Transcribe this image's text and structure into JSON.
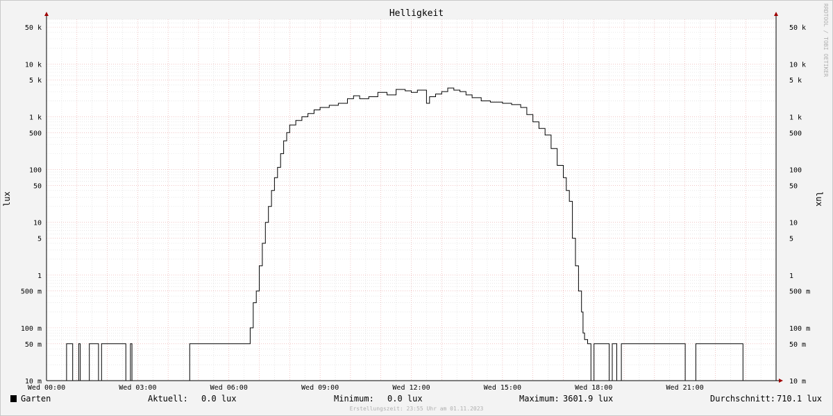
{
  "title": "Helligkeit",
  "side_credit": "RRDTOOL / TOBI OETIKER",
  "footer_text": "Erstellungszeit: 23:55 Uhr am 01.11.2023",
  "legend": {
    "series_name": "Garten",
    "series_color": "#000000",
    "current_label": "Aktuell:",
    "current_value": "0.0 lux",
    "min_label": "Minimum:",
    "min_value": "0.0 lux",
    "max_label": "Maximum:",
    "max_value": "3601.9 lux",
    "avg_label": "Durchschnitt:",
    "avg_value": "710.1 lux"
  },
  "colors": {
    "background": "#ffffff",
    "major_grid": "#e8a0a0",
    "minor_grid": "#d8d8d8",
    "axis": "#000000",
    "arrow": "#a00000",
    "line": "#000000"
  },
  "chart_data": {
    "type": "line",
    "title": "Helligkeit",
    "xlabel": "",
    "ylabel": "lux",
    "y_scale": "log",
    "ylim": [
      0.01,
      70000
    ],
    "xlim": [
      0,
      24
    ],
    "grid": true,
    "x_ticks": [
      {
        "value": 0,
        "label": "Wed 00:00"
      },
      {
        "value": 3,
        "label": "Wed 03:00"
      },
      {
        "value": 6,
        "label": "Wed 06:00"
      },
      {
        "value": 9,
        "label": "Wed 09:00"
      },
      {
        "value": 12,
        "label": "Wed 12:00"
      },
      {
        "value": 15,
        "label": "Wed 15:00"
      },
      {
        "value": 18,
        "label": "Wed 18:00"
      },
      {
        "value": 21,
        "label": "Wed 21:00"
      }
    ],
    "y_ticks": [
      {
        "value": 0.01,
        "label": "10 m"
      },
      {
        "value": 0.05,
        "label": "50 m"
      },
      {
        "value": 0.1,
        "label": "100 m"
      },
      {
        "value": 0.5,
        "label": "500 m"
      },
      {
        "value": 1,
        "label": "1"
      },
      {
        "value": 5,
        "label": "5"
      },
      {
        "value": 10,
        "label": "10"
      },
      {
        "value": 50,
        "label": "50"
      },
      {
        "value": 100,
        "label": "100"
      },
      {
        "value": 500,
        "label": "500"
      },
      {
        "value": 1000,
        "label": "1 k"
      },
      {
        "value": 5000,
        "label": "5 k"
      },
      {
        "value": 10000,
        "label": "10 k"
      },
      {
        "value": 50000,
        "label": "50 k"
      }
    ],
    "series": [
      {
        "name": "Garten",
        "points": [
          [
            0.0,
            0.01
          ],
          [
            0.65,
            0.01
          ],
          [
            0.66,
            0.05
          ],
          [
            0.85,
            0.05
          ],
          [
            0.86,
            0.01
          ],
          [
            1.05,
            0.01
          ],
          [
            1.06,
            0.05
          ],
          [
            1.1,
            0.05
          ],
          [
            1.11,
            0.01
          ],
          [
            1.4,
            0.01
          ],
          [
            1.41,
            0.05
          ],
          [
            1.7,
            0.05
          ],
          [
            1.71,
            0.01
          ],
          [
            1.8,
            0.01
          ],
          [
            1.81,
            0.05
          ],
          [
            2.6,
            0.05
          ],
          [
            2.61,
            0.01
          ],
          [
            2.75,
            0.01
          ],
          [
            2.76,
            0.05
          ],
          [
            2.8,
            0.05
          ],
          [
            2.81,
            0.01
          ],
          [
            4.7,
            0.01
          ],
          [
            4.71,
            0.05
          ],
          [
            6.6,
            0.05
          ],
          [
            6.7,
            0.1
          ],
          [
            6.8,
            0.3
          ],
          [
            6.9,
            0.5
          ],
          [
            7.0,
            1.5
          ],
          [
            7.1,
            4
          ],
          [
            7.2,
            10
          ],
          [
            7.3,
            20
          ],
          [
            7.4,
            40
          ],
          [
            7.5,
            70
          ],
          [
            7.6,
            110
          ],
          [
            7.7,
            200
          ],
          [
            7.8,
            350
          ],
          [
            7.9,
            500
          ],
          [
            8.0,
            700
          ],
          [
            8.2,
            850
          ],
          [
            8.4,
            1000
          ],
          [
            8.6,
            1150
          ],
          [
            8.8,
            1350
          ],
          [
            9.0,
            1500
          ],
          [
            9.3,
            1650
          ],
          [
            9.6,
            1800
          ],
          [
            9.9,
            2200
          ],
          [
            10.1,
            2500
          ],
          [
            10.3,
            2200
          ],
          [
            10.6,
            2400
          ],
          [
            10.9,
            2900
          ],
          [
            11.2,
            2600
          ],
          [
            11.5,
            3300
          ],
          [
            11.8,
            3100
          ],
          [
            12.0,
            2900
          ],
          [
            12.2,
            3200
          ],
          [
            12.5,
            1800
          ],
          [
            12.6,
            2400
          ],
          [
            12.8,
            2700
          ],
          [
            13.0,
            3000
          ],
          [
            13.2,
            3500
          ],
          [
            13.4,
            3200
          ],
          [
            13.6,
            3000
          ],
          [
            13.8,
            2600
          ],
          [
            14.0,
            2300
          ],
          [
            14.3,
            2000
          ],
          [
            14.6,
            1900
          ],
          [
            15.0,
            1800
          ],
          [
            15.3,
            1700
          ],
          [
            15.6,
            1500
          ],
          [
            15.8,
            1100
          ],
          [
            16.0,
            800
          ],
          [
            16.2,
            600
          ],
          [
            16.4,
            450
          ],
          [
            16.6,
            250
          ],
          [
            16.8,
            120
          ],
          [
            17.0,
            70
          ],
          [
            17.1,
            40
          ],
          [
            17.2,
            25
          ],
          [
            17.3,
            5
          ],
          [
            17.4,
            1.5
          ],
          [
            17.5,
            0.5
          ],
          [
            17.6,
            0.2
          ],
          [
            17.65,
            0.08
          ],
          [
            17.7,
            0.06
          ],
          [
            17.8,
            0.05
          ],
          [
            17.9,
            0.05
          ],
          [
            17.91,
            0.01
          ],
          [
            18.0,
            0.01
          ],
          [
            18.01,
            0.05
          ],
          [
            18.5,
            0.05
          ],
          [
            18.51,
            0.01
          ],
          [
            18.6,
            0.01
          ],
          [
            18.61,
            0.05
          ],
          [
            18.75,
            0.05
          ],
          [
            18.76,
            0.01
          ],
          [
            18.9,
            0.01
          ],
          [
            18.91,
            0.05
          ],
          [
            21.0,
            0.05
          ],
          [
            21.01,
            0.01
          ],
          [
            21.35,
            0.01
          ],
          [
            21.36,
            0.05
          ],
          [
            22.9,
            0.05
          ],
          [
            22.91,
            0.01
          ],
          [
            24.0,
            0.01
          ]
        ]
      }
    ]
  }
}
